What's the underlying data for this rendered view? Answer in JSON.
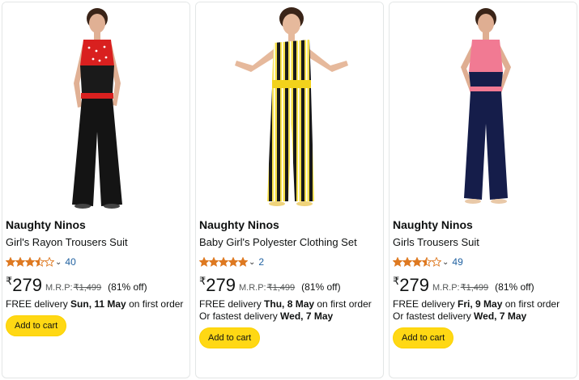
{
  "products": [
    {
      "brand": "Naughty Ninos",
      "title": "Girl's Rayon Trousers Suit",
      "rating": 3.5,
      "review_count": "40",
      "currency": "₹",
      "price": "279",
      "mrp_label": "M.R.P:",
      "mrp": "₹1,499",
      "discount": "(81% off)",
      "delivery_prefix": "FREE delivery ",
      "delivery_date": "Sun, 11 May",
      "delivery_suffix": " on first order",
      "fastest_prefix": "",
      "fastest_date": "",
      "cart_label": "Add to cart"
    },
    {
      "brand": "Naughty Ninos",
      "title": "Baby Girl's Polyester Clothing Set",
      "rating": 5,
      "review_count": "2",
      "currency": "₹",
      "price": "279",
      "mrp_label": "M.R.P:",
      "mrp": "₹1,499",
      "discount": "(81% off)",
      "delivery_prefix": "FREE delivery ",
      "delivery_date": "Thu, 8 May",
      "delivery_suffix": " on first order",
      "fastest_prefix": "Or fastest delivery ",
      "fastest_date": "Wed, 7 May",
      "cart_label": "Add to cart"
    },
    {
      "brand": "Naughty Ninos",
      "title": "Girls Trousers Suit",
      "rating": 3.5,
      "review_count": "49",
      "currency": "₹",
      "price": "279",
      "mrp_label": "M.R.P:",
      "mrp": "₹1,499",
      "discount": "(81% off)",
      "delivery_prefix": "FREE delivery ",
      "delivery_date": "Fri, 9 May",
      "delivery_suffix": " on first order",
      "fastest_prefix": "Or fastest delivery ",
      "fastest_date": "Wed, 7 May",
      "cart_label": "Add to cart"
    }
  ],
  "colors": {
    "star": "#de7921",
    "link": "#2162a1",
    "button": "#ffd814"
  },
  "icons": {
    "star": "star-icon",
    "dropdown": "chevron-down-icon"
  }
}
